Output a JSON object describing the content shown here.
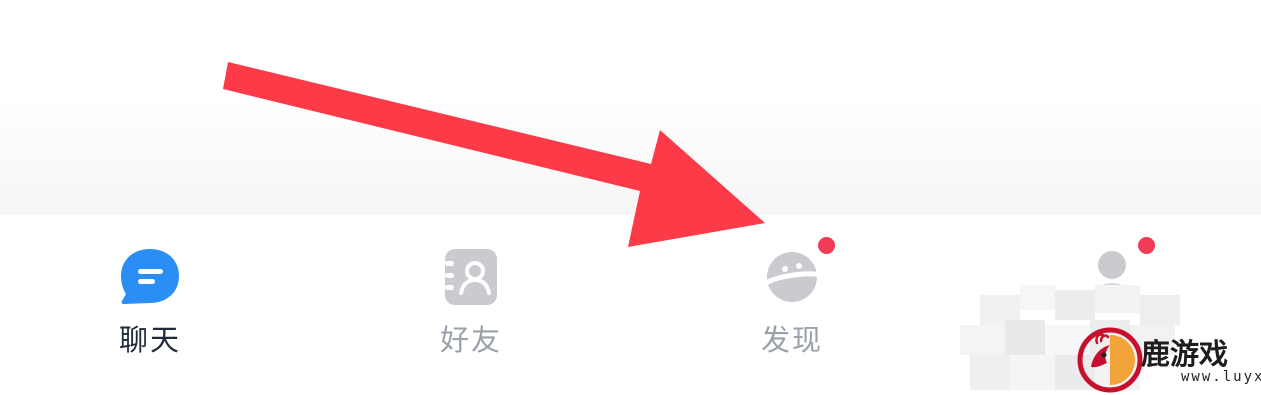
{
  "tabs": [
    {
      "id": "chat",
      "label": "聊天",
      "icon": "chat-bubble-icon",
      "active": true,
      "badge": false
    },
    {
      "id": "friends",
      "label": "好友",
      "icon": "contacts-icon",
      "active": false,
      "badge": false
    },
    {
      "id": "discover",
      "label": "发现",
      "icon": "planet-icon",
      "active": false,
      "badge": true
    },
    {
      "id": "me",
      "label": "",
      "icon": "person-icon",
      "active": false,
      "badge": true
    }
  ],
  "watermark": {
    "text": "鹿游戏",
    "url": "www.luyx.cn",
    "logo": "deer-logo-icon"
  },
  "annotation": {
    "type": "arrow",
    "target": "tab-discover"
  },
  "colors": {
    "accent_blue": "#2b8ef5",
    "active_label": "#1f2a3a",
    "inactive_label": "#9aa1ab",
    "inactive_icon": "#c9cbcf",
    "badge_red": "#f23b57",
    "arrow_red": "#fc3a48"
  }
}
